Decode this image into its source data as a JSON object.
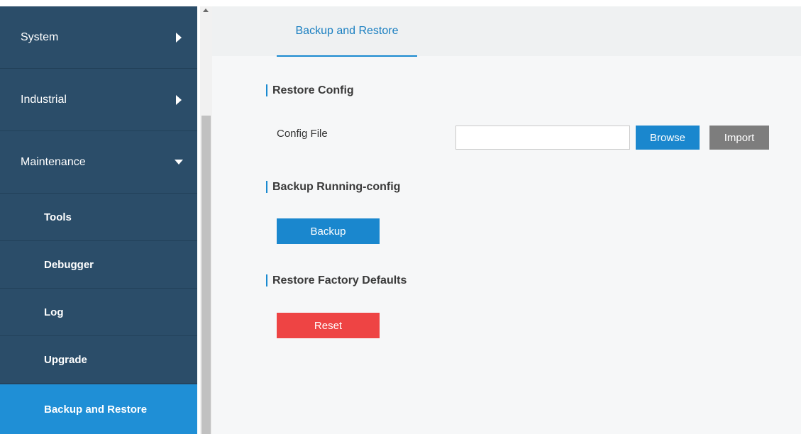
{
  "sidebar": {
    "items": [
      {
        "label": "System",
        "icon": "caret-right-icon"
      },
      {
        "label": "Industrial",
        "icon": "caret-right-icon"
      },
      {
        "label": "Maintenance",
        "icon": "caret-down-icon"
      },
      {
        "label": "Tools"
      },
      {
        "label": "Debugger"
      },
      {
        "label": "Log"
      },
      {
        "label": "Upgrade"
      },
      {
        "label": "Backup and Restore",
        "active": true
      }
    ]
  },
  "tabs": [
    {
      "label": "Backup and Restore",
      "active": true
    }
  ],
  "restore_config": {
    "title": "Restore Config",
    "field_label": "Config File",
    "file_value": "",
    "browse_label": "Browse",
    "import_label": "Import"
  },
  "backup_running": {
    "title": "Backup Running-config",
    "backup_label": "Backup"
  },
  "factory_defaults": {
    "title": "Restore Factory Defaults",
    "reset_label": "Reset"
  },
  "colors": {
    "sidebar_bg": "#2b4d69",
    "sidebar_active": "#1f8fd6",
    "accent": "#1a87ce",
    "reset": "#ee4444",
    "import": "#7d7d7d"
  }
}
